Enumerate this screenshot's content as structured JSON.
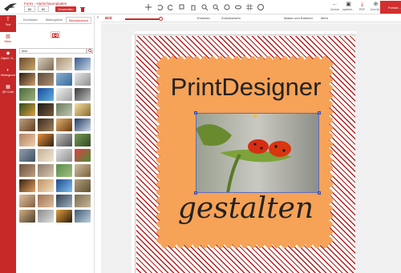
{
  "header": {
    "product": "Forex - Hartschaumplatten",
    "width_label": "Breite",
    "width_value": "80",
    "height_label": "Höhe",
    "height_value": "80",
    "apply_label": "Anwenden"
  },
  "nav": {
    "back": "Zurück",
    "save": "speiche...",
    "pdf": "PDF",
    "cart": "Zum W...",
    "forward": "Fortset..."
  },
  "sidebar": {
    "items": [
      {
        "label": "Text",
        "icon": "text-icon"
      },
      {
        "label": "Bilder",
        "icon": "image-icon"
      },
      {
        "label": "Objekt / S...",
        "icon": "shapes-icon"
      },
      {
        "label": "Hintergrund",
        "icon": "background-icon"
      },
      {
        "label": "QR Code",
        "icon": "qr-icon"
      }
    ]
  },
  "panel": {
    "tabs": [
      "Hochladen",
      "Bildergalerie",
      "Bilddatenbank"
    ],
    "search_value": "tiere"
  },
  "toolbar": {
    "label": "Bild",
    "ersetzen": "Ersetzen",
    "zuruecksetzen": "Zurücksetzen",
    "maske": "Maske und Rahmen",
    "mehr": "Mehr"
  },
  "canvas": {
    "headline": "PrintDesigner",
    "subline": "gestalten"
  }
}
